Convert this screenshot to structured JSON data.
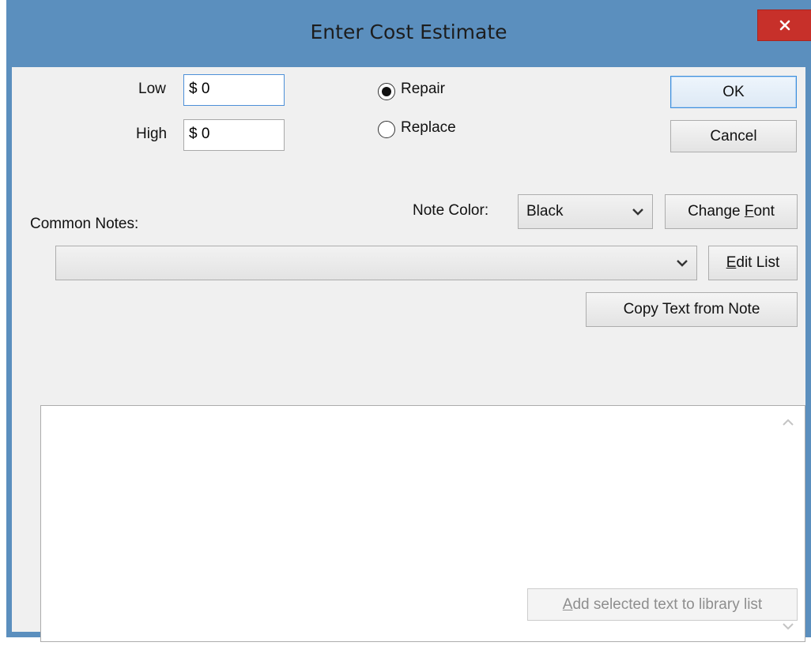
{
  "window": {
    "title": "Enter Cost Estimate",
    "close_icon": "close-icon"
  },
  "estimate": {
    "low_label": "Low",
    "low_value": "$ 0",
    "high_label": "High",
    "high_value": "$ 0"
  },
  "mode": {
    "options": [
      {
        "label": "Repair",
        "checked": true
      },
      {
        "label": "Replace",
        "checked": false
      }
    ]
  },
  "buttons": {
    "ok": "OK",
    "cancel": "Cancel",
    "change_font_pre": "Change ",
    "change_font_mnemonic": "F",
    "change_font_post": "ont",
    "edit_list_mnemonic": "E",
    "edit_list_post": "dit List",
    "copy_text": "Copy Text from Note",
    "add_selected_mnemonic": "A",
    "add_selected_post": "dd selected text to library list"
  },
  "note_color": {
    "label": "Note Color:",
    "value": "Black"
  },
  "common_notes": {
    "label": "Common Notes:",
    "value": ""
  },
  "note_text": {
    "value": ""
  },
  "colors": {
    "title_bar": "#5b8fbe",
    "close_button": "#c7302a",
    "client_bg": "#f0f0f0",
    "focus_border": "#4d90d8"
  }
}
